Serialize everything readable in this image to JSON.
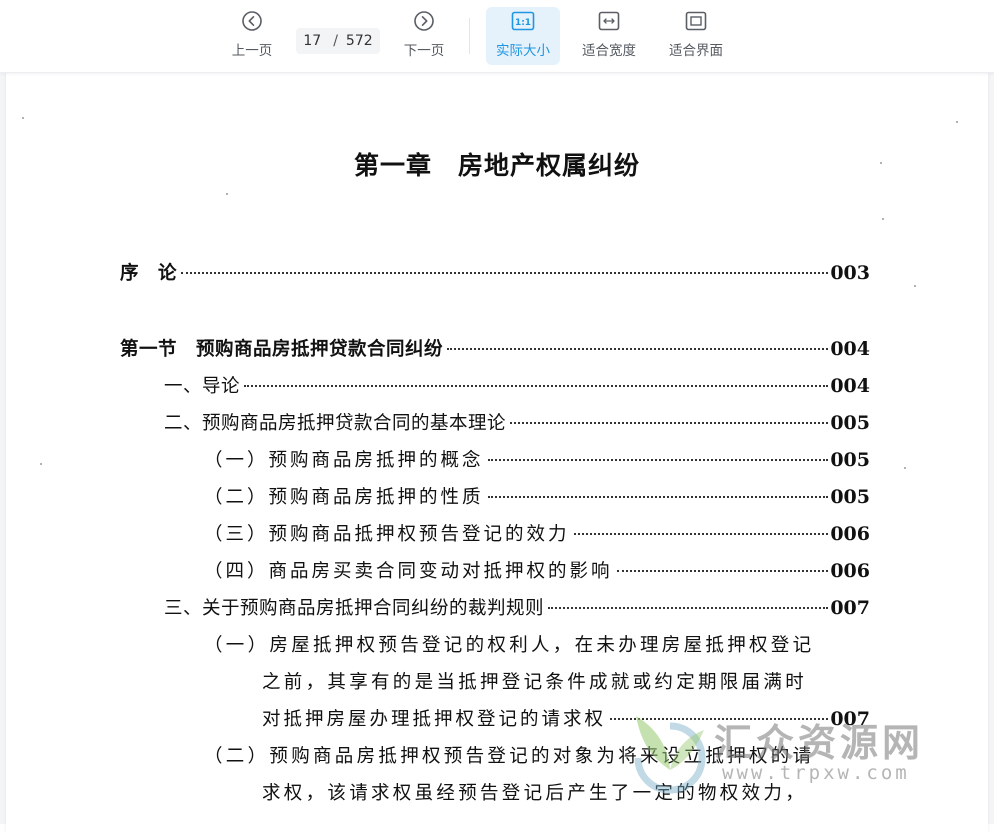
{
  "toolbar": {
    "prev_label": "上一页",
    "next_label": "下一页",
    "current_page": "17",
    "page_separator": "/",
    "total_pages": "572",
    "actual_size_label": "实际大小",
    "actual_size_icon_text": "1:1",
    "fit_width_label": "适合宽度",
    "fit_page_label": "适合界面",
    "accent_color": "#2196e0",
    "active_bg": "#e5f2fc"
  },
  "document": {
    "chapter_title": "第一章　房地产权属纠纷",
    "entries": [
      {
        "text": "序　论",
        "page": "003"
      },
      {
        "text": "第一节　预购商品房抵押贷款合同纠纷",
        "page": "004"
      },
      {
        "text": "一、导论",
        "page": "004"
      },
      {
        "text": "二、预购商品房抵押贷款合同的基本理论",
        "page": "005"
      },
      {
        "text": "（一）预购商品房抵押的概念",
        "page": "005"
      },
      {
        "text": "（二）预购商品房抵押的性质",
        "page": "005"
      },
      {
        "text": "（三）预购商品抵押权预告登记的效力",
        "page": "006"
      },
      {
        "text": "（四）商品房买卖合同变动对抵押权的影响",
        "page": "006"
      },
      {
        "text": "三、关于预购商品房抵押合同纠纷的裁判规则",
        "page": "007"
      },
      {
        "text": "（一）房屋抵押权预告登记的权利人，在未办理房屋抵押权登记",
        "page": ""
      },
      {
        "text": "之前，其享有的是当抵押登记条件成就或约定期限届满时",
        "page": ""
      },
      {
        "text": "对抵押房屋办理抵押权登记的请求权",
        "page": "007"
      },
      {
        "text": "（二）预购商品房抵押权预告登记的对象为将来设立抵押权的请",
        "page": ""
      },
      {
        "text": "求权，该请求权虽经预告登记后产生了一定的物权效力，",
        "page": ""
      }
    ]
  },
  "watermark": {
    "title": "汇众资源网",
    "url": "www.trpxw.com"
  }
}
